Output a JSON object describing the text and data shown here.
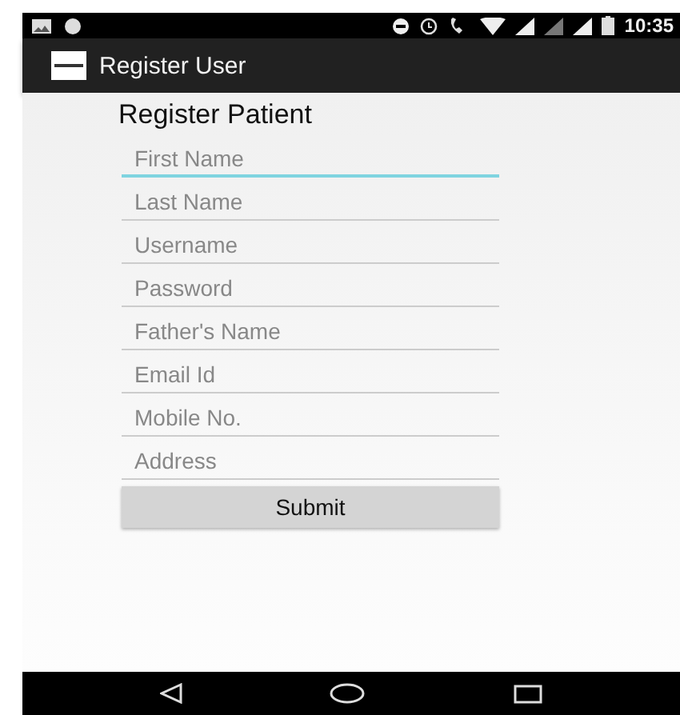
{
  "status_bar": {
    "time": "10:35"
  },
  "app_bar": {
    "title": "Register User"
  },
  "form": {
    "title": "Register Patient",
    "fields": [
      {
        "placeholder": "First Name",
        "focused": true
      },
      {
        "placeholder": "Last Name",
        "focused": false
      },
      {
        "placeholder": "Username",
        "focused": false
      },
      {
        "placeholder": "Password",
        "focused": false
      },
      {
        "placeholder": "Father's Name",
        "focused": false
      },
      {
        "placeholder": "Email Id",
        "focused": false
      },
      {
        "placeholder": "Mobile No.",
        "focused": false
      },
      {
        "placeholder": "Address",
        "focused": false
      }
    ],
    "submit": "Submit"
  }
}
